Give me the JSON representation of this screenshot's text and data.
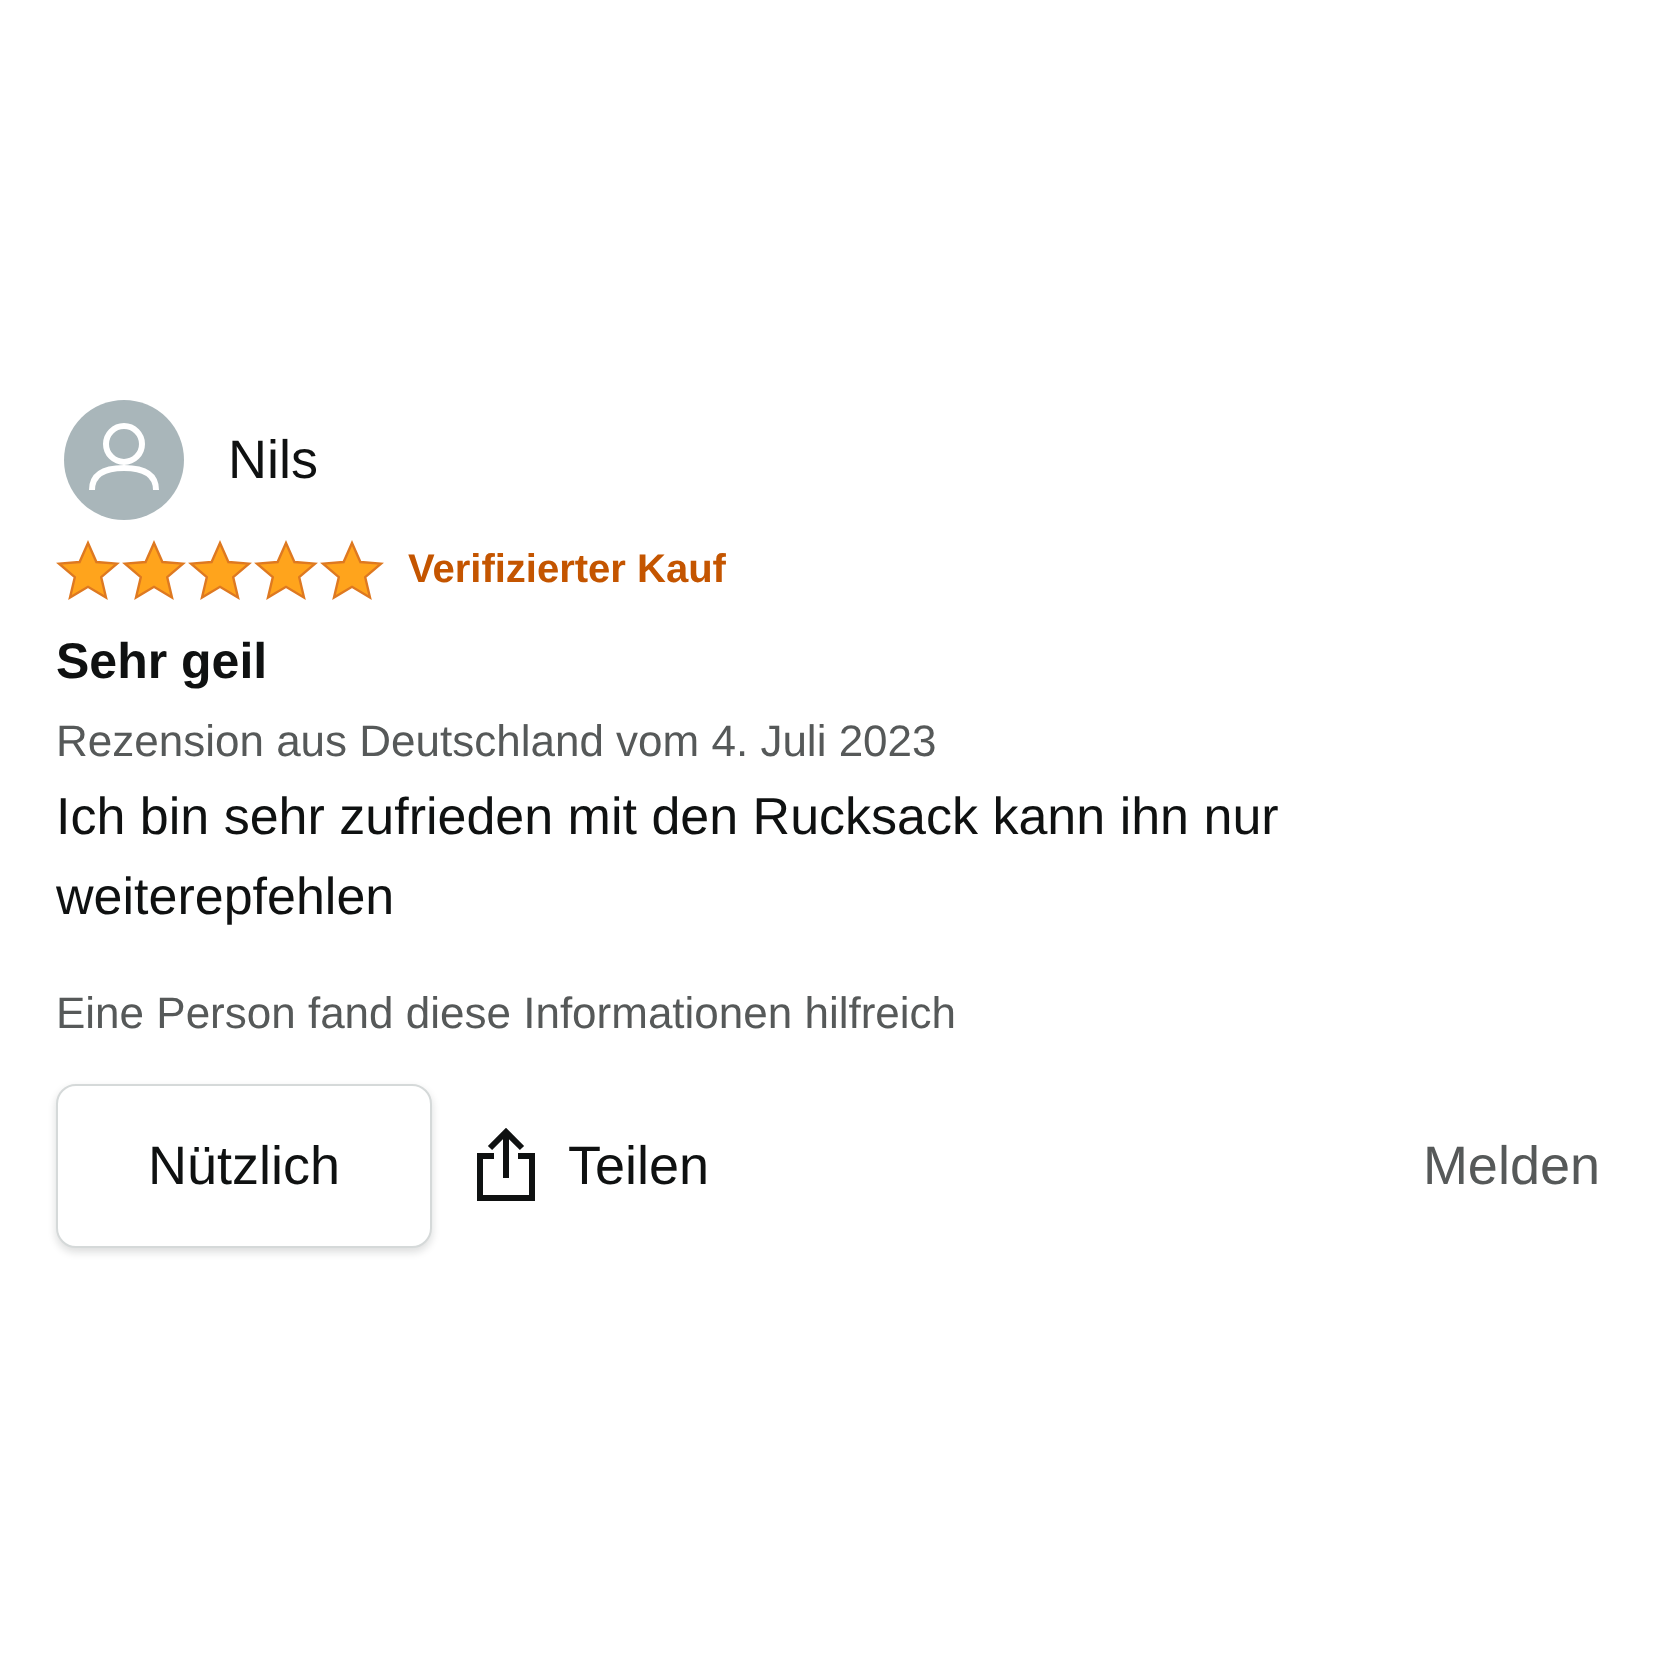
{
  "review": {
    "author": "Nils",
    "stars": 5,
    "badge": "Verifizierter Kauf",
    "title": "Sehr geil",
    "meta": "Rezension aus Deutschland vom 4. Juli 2023",
    "body": "Ich bin sehr zufrieden mit den Rucksack kann ihn nur weiterepfehlen",
    "helpful_count": "Eine Person fand diese Informationen hilfreich"
  },
  "actions": {
    "helpful_button": "Nützlich",
    "share": "Teilen",
    "report": "Melden"
  }
}
